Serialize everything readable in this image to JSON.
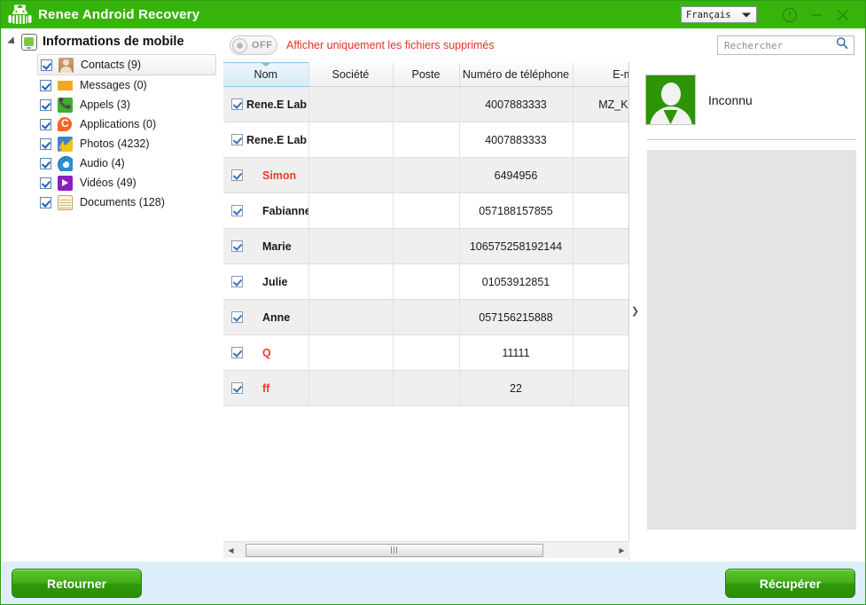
{
  "window": {
    "title": "Renee Android Recovery",
    "logo_icon": "android-robot-nurse-icon",
    "language": {
      "selected": "Français",
      "caret_icon": "chevron-down-icon"
    },
    "controls": {
      "info_icon": "info-circle-icon",
      "minimize_icon": "minimize-icon",
      "close_icon": "close-icon"
    }
  },
  "sidebar": {
    "expander_icon": "tree-collapse-arrow-icon",
    "root_icon": "mobile-phone-icon",
    "root_label": "Informations de mobile",
    "items": [
      {
        "label": "Contacts (9)",
        "icon": "contacts-icon",
        "checked": true,
        "selected": true
      },
      {
        "label": "Messages (0)",
        "icon": "messages-icon",
        "checked": true,
        "selected": false
      },
      {
        "label": "Appels (3)",
        "icon": "calls-icon",
        "checked": true,
        "selected": false
      },
      {
        "label": "Applications (0)",
        "icon": "applications-icon",
        "checked": true,
        "selected": false
      },
      {
        "label": "Photos (4232)",
        "icon": "photos-icon",
        "checked": true,
        "selected": false
      },
      {
        "label": "Audio (4)",
        "icon": "audio-icon",
        "checked": true,
        "selected": false
      },
      {
        "label": "Vidéos (49)",
        "icon": "videos-icon",
        "checked": true,
        "selected": false
      },
      {
        "label": "Documents (128)",
        "icon": "documents-icon",
        "checked": true,
        "selected": false
      }
    ]
  },
  "toolbar": {
    "toggle_state": "OFF",
    "toggle_label": "OFF",
    "deleted_only_label": "Afficher uniquement les fichiers supprimés",
    "search": {
      "value": "",
      "placeholder": "Rechercher",
      "icon": "search-icon"
    }
  },
  "table": {
    "sort_column": "Nom",
    "sort_caret_icon": "sort-ascending-icon",
    "columns": [
      {
        "key": "name",
        "label": "Nom"
      },
      {
        "key": "company",
        "label": "Société"
      },
      {
        "key": "post",
        "label": "Poste"
      },
      {
        "key": "phone",
        "label": "Numéro de téléphone"
      },
      {
        "key": "email",
        "label": "E-mail"
      }
    ],
    "rows": [
      {
        "checked": true,
        "name": "Rene.E Lab",
        "company": "",
        "post": "",
        "phone": "4007883333",
        "email": "MZ_KF@m.",
        "deleted": false,
        "indent": false
      },
      {
        "checked": true,
        "name": "Rene.E Lab",
        "company": "",
        "post": "",
        "phone": "4007883333",
        "email": "",
        "deleted": false,
        "indent": false
      },
      {
        "checked": true,
        "name": "Simon",
        "company": "",
        "post": "",
        "phone": "6494956",
        "email": "",
        "deleted": true,
        "indent": true
      },
      {
        "checked": true,
        "name": "Fabianne",
        "company": "",
        "post": "",
        "phone": "057188157855",
        "email": "",
        "deleted": false,
        "indent": true
      },
      {
        "checked": true,
        "name": "Marie",
        "company": "",
        "post": "",
        "phone": "106575258192144",
        "email": "",
        "deleted": false,
        "indent": true
      },
      {
        "checked": true,
        "name": "Julie",
        "company": "",
        "post": "",
        "phone": "01053912851",
        "email": "",
        "deleted": false,
        "indent": true
      },
      {
        "checked": true,
        "name": "Anne",
        "company": "",
        "post": "",
        "phone": "057156215888",
        "email": "",
        "deleted": false,
        "indent": true
      },
      {
        "checked": true,
        "name": "Q",
        "company": "",
        "post": "",
        "phone": "11111",
        "email": "",
        "deleted": true,
        "indent": true
      },
      {
        "checked": true,
        "name": "ff",
        "company": "",
        "post": "",
        "phone": "22",
        "email": "",
        "deleted": true,
        "indent": true
      }
    ]
  },
  "scrollbar": {
    "left_arrow_icon": "arrow-left-icon",
    "right_arrow_icon": "arrow-right-icon",
    "grip_icon": "scrollbar-grip-icon"
  },
  "splitter": {
    "collapse_icon": "chevron-right-icon"
  },
  "preview": {
    "avatar_icon": "person-avatar-icon",
    "contact_name": "Inconnu"
  },
  "footer": {
    "back_label": "Retourner",
    "recover_label": "Récupérer"
  },
  "colors": {
    "brand_green": "#37b40b",
    "button_green": "#41ac16",
    "deleted_red": "#f0392c",
    "warning_red": "#e8302a",
    "footer_blue": "#ddeefb"
  }
}
